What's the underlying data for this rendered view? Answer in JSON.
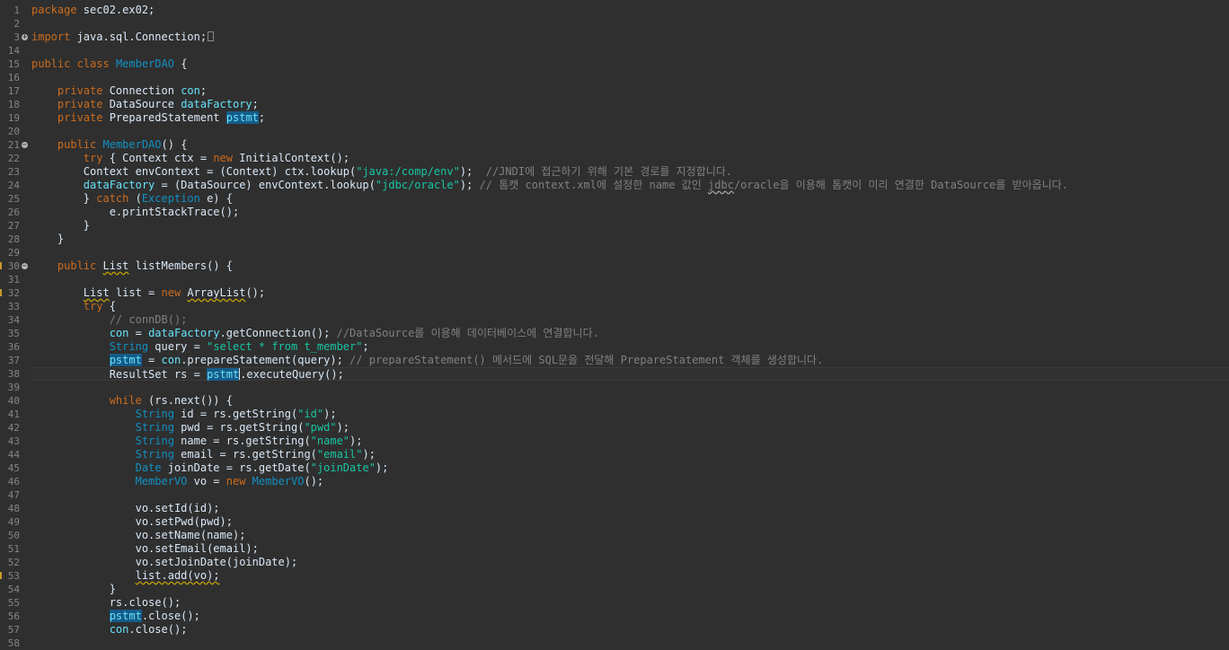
{
  "editor": {
    "line_numbers": [
      "1",
      "2",
      "3",
      "14",
      "15",
      "16",
      "17",
      "18",
      "19",
      "20",
      "21",
      "22",
      "23",
      "24",
      "25",
      "26",
      "27",
      "28",
      "29",
      "30",
      "31",
      "32",
      "33",
      "34",
      "35",
      "36",
      "37",
      "38",
      "39",
      "40",
      "41",
      "42",
      "43",
      "44",
      "45",
      "46",
      "47",
      "48",
      "49",
      "50",
      "51",
      "52",
      "53",
      "54",
      "55",
      "56",
      "57",
      "58"
    ],
    "current_line": "38",
    "fold_markers": [
      "3",
      "21",
      "30"
    ],
    "code": {
      "l1_kw": "package",
      "l1_rest": " sec02.ex02;",
      "l3_kw": "import",
      "l3_rest": " java.sql.Connection;",
      "l15_kw1": "public",
      "l15_kw2": "class",
      "l15_name": "MemberDAO",
      "l15_rest": " {",
      "l17_kw": "private",
      "l17_rest": " Connection ",
      "l17_fld": "con",
      "l18_kw": "private",
      "l18_rest": " DataSource ",
      "l18_fld": "dataFactory",
      "l19_kw": "private",
      "l19_rest": " PreparedStatement ",
      "l19_fld": "pstmt",
      "l21_kw": "public",
      "l21_name": "MemberDAO",
      "l21_rest": "() {",
      "l22_kw": "try",
      "l22_a": " { Context ctx = ",
      "l22_new": "new",
      "l22_b": " InitialContext();",
      "l23_a": "Context envContext = (Context) ctx.lookup(",
      "l23_str": "\"java:/comp/env\"",
      "l23_b": ");  ",
      "l23_cmt": "//JNDI에 접근하기 위해 기본 경로를 지정합니다.",
      "l24_fld": "dataFactory",
      "l24_a": " = (DataSource) envContext.lookup(",
      "l24_str": "\"jdbc/oracle\"",
      "l24_b": "); ",
      "l24_cmt1": "// 톰캣 context.xml에 설정한 name 값인 ",
      "l24_cmt2": "jdbc",
      "l24_cmt3": "/oracle을 이용해 톰캣이 미리 연결한 DataSource를 받아옵니다.",
      "l25_a": "} ",
      "l25_kw": "catch",
      "l25_b": " (",
      "l25_type": "Exception",
      "l25_c": " e) {",
      "l26": "e.printStackTrace();",
      "l27": "}",
      "l28": "}",
      "l30_kw": "public",
      "l30_type": "List",
      "l30_rest": " listMembers() {",
      "l32_type": "List",
      "l32_a": " list = ",
      "l32_new": "new",
      "l32_type2": "ArrayList",
      "l32_b": "();",
      "l33_kw": "try",
      "l33_rest": " {",
      "l34_cmt": "// connDB();",
      "l35_fld": "con",
      "l35_a": " = ",
      "l35_fld2": "dataFactory",
      "l35_b": ".getConnection(); ",
      "l35_cmt": "//DataSource를 이용해 데이터베이스에 연결합니다.",
      "l36_type": "String",
      "l36_a": " query = ",
      "l36_str": "\"select * from t_member\"",
      "l36_b": ";",
      "l37_fld": "pstmt",
      "l37_a": " = ",
      "l37_fld2": "con",
      "l37_b": ".prepareStatement(query); ",
      "l37_cmt": "// prepareStatement() 메서드에 SQL문을 전달해 PrepareStatement 객체를 생성합니다.",
      "l38_a": "ResultSet rs = ",
      "l38_fld": "pstmt",
      "l38_b": ".executeQuery();",
      "l40_kw": "while",
      "l40_rest": " (rs.next()) {",
      "l41_type": "String",
      "l41_a": " id = rs.getString(",
      "l41_str": "\"id\"",
      "l41_b": ");",
      "l42_type": "String",
      "l42_a": " pwd = rs.getString(",
      "l42_str": "\"pwd\"",
      "l42_b": ");",
      "l43_type": "String",
      "l43_a": " name = rs.getString(",
      "l43_str": "\"name\"",
      "l43_b": ");",
      "l44_type": "String",
      "l44_a": " email = rs.getString(",
      "l44_str": "\"email\"",
      "l44_b": ");",
      "l45_type": "Date",
      "l45_a": " joinDate = rs.getDate(",
      "l45_str": "\"joinDate\"",
      "l45_b": ");",
      "l46_type": "MemberVO",
      "l46_a": " vo = ",
      "l46_new": "new",
      "l46_type2": "MemberVO",
      "l46_b": "();",
      "l48": "vo.setId(id);",
      "l49": "vo.setPwd(pwd);",
      "l50": "vo.setName(name);",
      "l51": "vo.setEmail(email);",
      "l52": "vo.setJoinDate(joinDate);",
      "l53": "list.add(vo);",
      "l54": "}",
      "l55": "rs.close();",
      "l56_fld": "pstmt",
      "l56_rest": ".close();",
      "l57_fld": "con",
      "l57_rest": ".close();"
    }
  }
}
